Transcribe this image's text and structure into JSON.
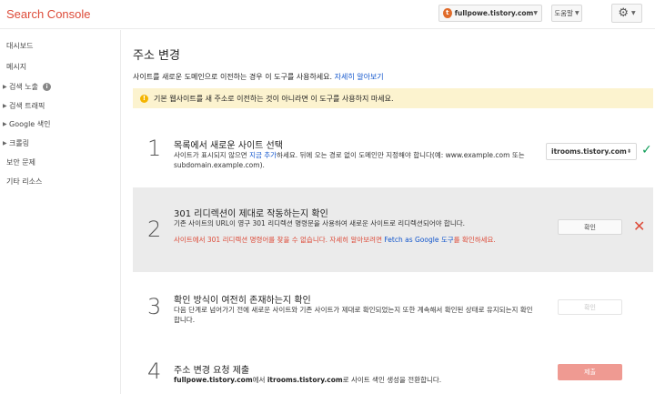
{
  "header": {
    "brand": "Search Console",
    "site_favicon_letter": "t",
    "site_name": "fullpowe.tistory.com",
    "help_label": "도움말",
    "icons": {
      "caret": "chevron-down-icon",
      "gear": "gear-icon"
    }
  },
  "sidebar": {
    "items": [
      {
        "label": "대시보드",
        "expandable": false
      },
      {
        "label": "메시지",
        "expandable": false
      },
      {
        "label": "검색 노출",
        "expandable": true,
        "info": "i"
      },
      {
        "label": "검색 트래픽",
        "expandable": true
      },
      {
        "label": "Google 색인",
        "expandable": true
      },
      {
        "label": "크롤링",
        "expandable": true
      },
      {
        "label": "보안 문제",
        "expandable": false
      },
      {
        "label": "기타 리소스",
        "expandable": false
      }
    ]
  },
  "main": {
    "title": "주소 변경",
    "intro_text": "사이트를 새로운 도메인으로 이전하는 경우 이 도구를 사용하세요.",
    "intro_link": "자세히 알아보기",
    "warning_icon": "!",
    "warning_text": "기본 웹사이트를 새 주소로 이전하는 것이 아니라면 이 도구를 사용하지 마세요.",
    "steps": [
      {
        "num": "1",
        "title": "목록에서 새로운 사이트 선택",
        "desc_a": "사이트가 표시되지 않으면",
        "desc_link": "지금 추가",
        "desc_b": "하세요. 뒤에 오는 경로 없이 도메인만 지정해야 합니다(예: www.example.com 또는 subdomain.example.com).",
        "select_value": "itrooms.tistory.com",
        "status": "check"
      },
      {
        "num": "2",
        "title": "301 리디렉션이 제대로 작동하는지 확인",
        "desc": "기존 사이트의 URL이 영구 301 리디렉션 명령문을 사용하여 새로운 사이트로 리디렉션되어야 합니다.",
        "error_a": "사이트에서 301 리디렉션 명령어를 찾을 수 없습니다. 자세히 알아보려면",
        "error_link": "Fetch as Google 도구",
        "error_b": "를 확인하세요.",
        "button": "확인",
        "status": "error"
      },
      {
        "num": "3",
        "title": "확인 방식이 여전히 존재하는지 확인",
        "desc": "다음 단계로 넘어가기 전에 새로운 사이트와 기존 사이트가 제대로 확인되었는지 또한 계속해서 확인된 상태로 유지되는지 확인합니다.",
        "button": "확인"
      },
      {
        "num": "4",
        "title": "주소 변경 요청 제출",
        "old_site": "fullpowe.tistory.com",
        "mid": "에서",
        "new_site": "itrooms.tistory.com",
        "desc_end": "로 사이트 색인 생성을 전환합니다.",
        "button": "제출"
      }
    ]
  },
  "colors": {
    "brand": "#dd4b39",
    "warning_bg": "#fcf3cf",
    "check": "#0f9d58",
    "error": "#dd4b39",
    "link": "#1155cc",
    "submit": "#ef9a92"
  }
}
